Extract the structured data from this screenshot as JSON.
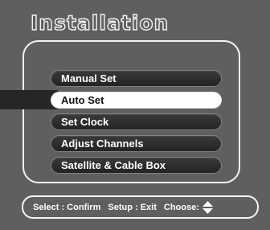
{
  "screen": {
    "title": "Installation"
  },
  "menu": {
    "items": [
      {
        "label": "Manual Set",
        "selected": false
      },
      {
        "label": "Auto Set",
        "selected": true
      },
      {
        "label": "Set Clock",
        "selected": false
      },
      {
        "label": "Adjust Channels",
        "selected": false
      },
      {
        "label": "Satellite & Cable Box",
        "selected": false
      }
    ]
  },
  "status_bar": {
    "select": "Select : Confirm",
    "setup": "Setup : Exit",
    "choose": "Choose:",
    "choose_icon": "up-down-arrows-icon"
  },
  "colors": {
    "background": "#5f5f5f",
    "frame": "#f4f4f4",
    "button": "#2b2b2b",
    "selected_button": "#ffffff",
    "selector_bar": "#262626"
  }
}
